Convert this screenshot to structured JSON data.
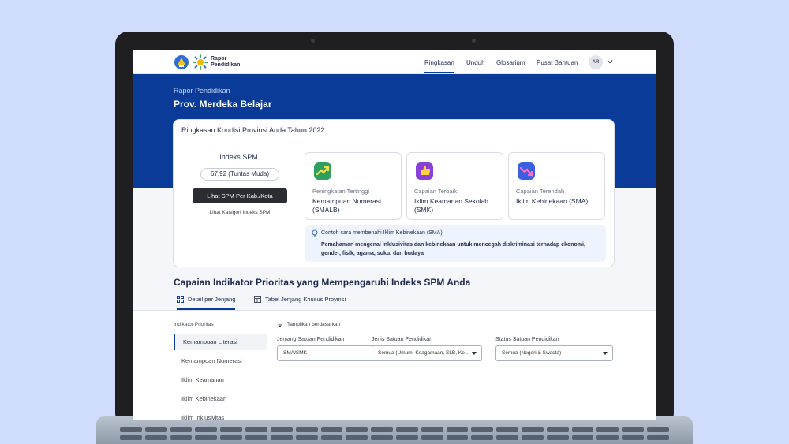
{
  "nav": {
    "logo_text_line1": "Rapor",
    "logo_text_line2": "Pendidikan",
    "links": [
      "Ringkasan",
      "Unduh",
      "Glosarium",
      "Pusat Bantuan"
    ],
    "active_link": "Ringkasan",
    "avatar": "AR"
  },
  "hero": {
    "subtitle": "Rapor Pendidikan",
    "title": "Prov. Merdeka Belajar"
  },
  "summary": {
    "title": "Ringkasan Kondisi Provinsi Anda Tahun 2022",
    "spm_label": "Indeks SPM",
    "spm_value": "67,92 (Tuntas Muda)",
    "spm_button": "Lihat SPM Per Kab./Kota",
    "spm_link": "Lihat Kategori Indeks SPM",
    "cards": [
      {
        "label": "Peningkatan Tertinggi",
        "value": "Kemampuan Numerasi (SMALB)",
        "icon": "chart-up-icon",
        "color": "#2e9e63"
      },
      {
        "label": "Capaian Terbaik",
        "value": "Iklim Keamanan Sekolah (SMK)",
        "icon": "thumbs-up-icon",
        "color": "#8b3fd9"
      },
      {
        "label": "Capaian Terendah",
        "value": "Iklim Kebinekaan (SMA)",
        "icon": "chart-down-icon",
        "color": "#3b5fe0"
      }
    ],
    "tip_title": "Contoh cara membenahi Iklim Kebinekaan (SMA)",
    "tip_body": "Pemahaman mengenai inklusivitas dan kebinekaan untuk mencegah diskriminasi terhadap ekonomi, gender, fisik, agama, suku, dan budaya"
  },
  "section": {
    "title": "Capaian Indikator Prioritas yang Mempengaruhi Indeks SPM Anda",
    "tabs": [
      "Detail per Jenjang",
      "Tabel Jenjang Khusus Provinsi"
    ]
  },
  "sidebar": {
    "heading": "Indikator Prioritas",
    "items": [
      "Kemampuan Literasi",
      "Kemampuan Numerasi",
      "Iklim Keamanan",
      "Iklim Kebinekaan",
      "Iklim Inklusivitas"
    ]
  },
  "filters": {
    "heading": "Tampilkan berdasarkan",
    "fields": [
      {
        "label": "Jenjang Satuan Pendidikan",
        "value": "SMA/SMK"
      },
      {
        "label": "Jenis Satuan Pendidikan",
        "value": "Semua (Umum, Keagamaan, SLB, Kes…"
      },
      {
        "label": "Status Satuan Pendidikan",
        "value": "Semua (Negeri & Swasta)"
      }
    ]
  },
  "colors": {
    "brand": "#0a3b98",
    "background": "#cfdcfb"
  }
}
